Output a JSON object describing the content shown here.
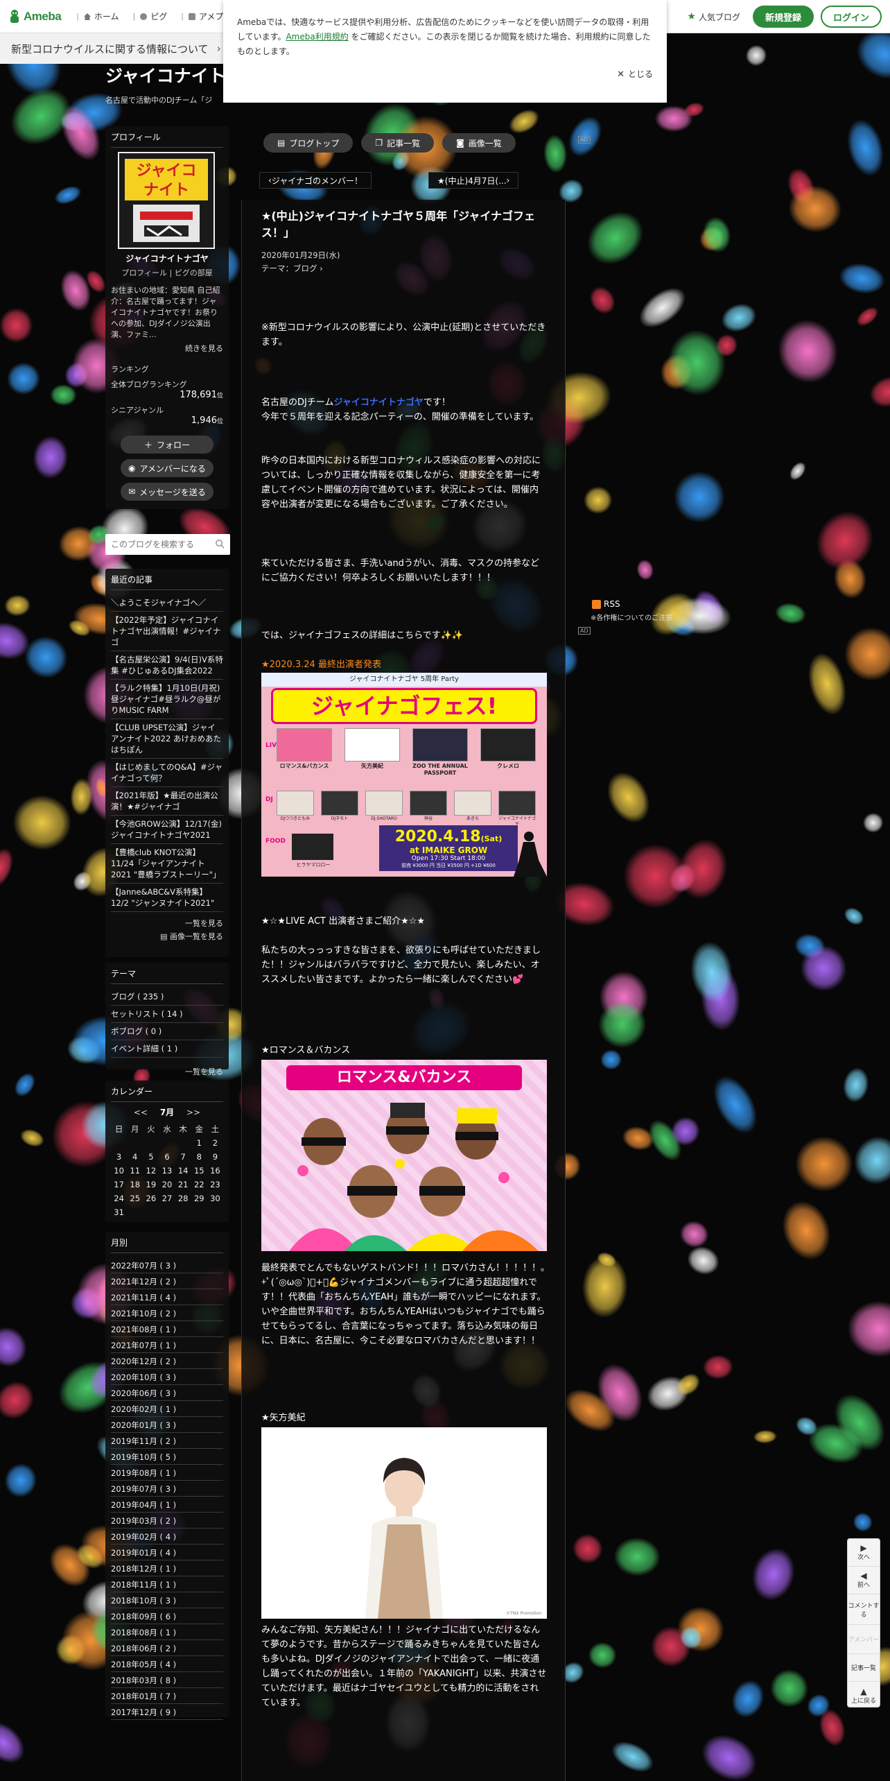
{
  "header": {
    "logo_text": "Ameba",
    "nav": [
      {
        "label": "ホーム",
        "icon": "home-icon"
      },
      {
        "label": "ピグ",
        "icon": "pigg-icon"
      },
      {
        "label": "アメプロ",
        "icon": "ameblo-icon"
      }
    ],
    "popular_label": "人気ブログ",
    "signup_label": "新規登録",
    "login_label": "ログイン"
  },
  "infobar": {
    "text": "新型コロナウイルスに関する情報について"
  },
  "cookie": {
    "text_before": "Amebaでは、快適なサービス提供や利用分析、広告配信のためにクッキーなどを使い訪問データの取得・利用しています。",
    "link_text": "Ameba利用規約",
    "text_after": "をご確認ください。この表示を閉じるか閲覧を続けた場合、利用規約に同意したものとします。",
    "close_label": "とじる"
  },
  "blog": {
    "title": "ジャイコナイトナゴヤ",
    "title_visible": "ジャイコナイト",
    "description": "名古屋で活動中のDJチーム「ジ"
  },
  "profile": {
    "heading": "プロフィール",
    "name": "ジャイコナイトナゴヤ",
    "links": "プロフィール | ピグの部屋",
    "text": "お住まいの地域：愛知県 自己紹介：名古屋で踊ってます！ジャイコナイトナゴヤです！お祭りへの参加、DJダイノジ公演出演、ファミ...",
    "more": "続きを見る",
    "ranking_heading": "ランキング",
    "ranking_all_label": "全体ブログランキング",
    "ranking_all_value": "178,691",
    "ranking_senior_label": "シニアジャンル",
    "ranking_senior_value": "1,946",
    "rank_unit": "位",
    "follow_label": "フォロー",
    "amember_label": "アメンバーになる",
    "message_label": "メッセージを送る"
  },
  "search": {
    "placeholder": "このブログを検索する"
  },
  "recent": {
    "heading": "最近の記事",
    "items": [
      "＼ようこそジャイナゴへ／",
      "【2022年予定】ジャイコナイトナゴヤ出演情報！#ジャイナゴ",
      "【名古屋栄公演】9/4(日)V系特集 #ひじゅあるDJ集会2022",
      "【ラルク特集】1月10日(月祝)昼ジャイナゴ#昼ラルク@昼がりMUSIC FARM",
      "【CLUB UPSET公演】ジャイアンナイト2022 あけおめあたはちぽん",
      "【はじめましてのQ&A】#ジャイナゴって何？",
      "【2021年版】★最近の出演公演！★#ジャイナゴ",
      "【今池GROW公演】12/17(金)ジャイコナイトナゴヤ2021",
      "【豊橋club KNOT公演】11/24「ジャイアンナイト2021 \"豊橋ラブストーリー\"」",
      "【Janne&ABC&V系特集】12/2 \"ジャンヌナイト2021\""
    ],
    "more": "一覧を見る",
    "image_more": "画像一覧を見る"
  },
  "themes": {
    "heading": "テーマ",
    "items": [
      "ブログ ( 235 )",
      "セットリスト ( 14 )",
      "ボブログ ( 0 )",
      "イベント詳細 ( 1 )"
    ],
    "more": "一覧を見る"
  },
  "calendar": {
    "heading": "カレンダー",
    "prev": "<<",
    "month": "7月",
    "next": ">>",
    "weekdays": [
      "日",
      "月",
      "火",
      "水",
      "木",
      "金",
      "土"
    ],
    "weeks": [
      [
        "",
        "",
        "",
        "",
        "",
        "1",
        "2"
      ],
      [
        "3",
        "4",
        "5",
        "6",
        "7",
        "8",
        "9"
      ],
      [
        "10",
        "11",
        "12",
        "13",
        "14",
        "15",
        "16"
      ],
      [
        "17",
        "18",
        "19",
        "20",
        "21",
        "22",
        "23"
      ],
      [
        "24",
        "25",
        "26",
        "27",
        "28",
        "29",
        "30"
      ],
      [
        "31",
        "",
        "",
        "",
        "",
        "",
        ""
      ]
    ]
  },
  "archive": {
    "heading": "月別",
    "items": [
      "2022年07月 ( 3 )",
      "2021年12月 ( 2 )",
      "2021年11月 ( 4 )",
      "2021年10月 ( 2 )",
      "2021年08月 ( 1 )",
      "2021年07月 ( 1 )",
      "2020年12月 ( 2 )",
      "2020年10月 ( 3 )",
      "2020年06月 ( 3 )",
      "2020年02月 ( 1 )",
      "2020年01月 ( 3 )",
      "2019年11月 ( 2 )",
      "2019年10月 ( 5 )",
      "2019年08月 ( 1 )",
      "2019年07月 ( 3 )",
      "2019年04月 ( 1 )",
      "2019年03月 ( 2 )",
      "2019年02月 ( 4 )",
      "2019年01月 ( 4 )",
      "2018年12月 ( 1 )",
      "2018年11月 ( 1 )",
      "2018年10月 ( 3 )",
      "2018年09月 ( 6 )",
      "2018年08月 ( 1 )",
      "2018年06月 ( 2 )",
      "2018年05月 ( 4 )",
      "2018年03月 ( 8 )",
      "2018年01月 ( 7 )",
      "2017年12月 ( 9 )"
    ]
  },
  "main": {
    "tabs": [
      {
        "label": "ブログトップ",
        "icon": "blog-top-icon"
      },
      {
        "label": "記事一覧",
        "icon": "article-list-icon"
      },
      {
        "label": "画像一覧",
        "icon": "camera-icon"
      }
    ],
    "ad_label": "AD",
    "prev_link": "ジャイナゴのメンバー！",
    "next_link": "★(中止)4月7日(..."
  },
  "article": {
    "title": "★(中止)ジャイコナイトナゴヤ５周年「ジャイナゴフェス！」",
    "date": "2020年01月29日(水)",
    "theme": "テーマ：ブログ",
    "p_cancel": "※新型コロナウイルスの影響により、公演中止(延期)とさせていただきます。",
    "p_intro_1": "名古屋のDJチーム",
    "p_intro_link": "ジャイコナイトナゴヤ",
    "p_intro_2": "です！",
    "p_intro_3": "今年で５周年を迎える記念パーティーの、開催の準備をしています。",
    "p_covid": "昨今の日本国内における新型コロナウィルス感染症の影響への対応については、しっかり正確な情報を収集しながら、健康安全を第一に考慮してイベント開催の方向で進めています。状況によっては、開催内容や出演者が変更になる場合もございます。ご了承ください。",
    "p_thanks": "来ていただける皆さま、手洗いandうがい、消毒、マスクの持参などにご協力ください！何卒よろしくお願いいたします！！！",
    "p_details": "では、ジャイナゴフェスの詳細はこちらです✨✨",
    "flyer_caption": "★2020.3.24 最終出演者発表",
    "flyer": {
      "header": "ジャイコナイトナゴヤ 5周年 Party",
      "title": "ジャイナゴフェス!",
      "acts": [
        "ロマンス&バカンス",
        "矢方美紀",
        "ZOO THE ANNUAL PASSPORT",
        "クレメロ"
      ],
      "djs": [
        "DJつつきともみ",
        "DJネモト",
        "DJ.SHOTARO",
        "神谷",
        "あきら",
        "ジャイコナイトナゴヤ"
      ],
      "food": "ヒラヤマロロー",
      "date": "2020.4.18",
      "day": "(Sat)",
      "venue": "at IMAIKE GROW",
      "time": "Open 17:30  Start 18:00",
      "price": "前売 ¥3000 円 当日 ¥3500 円 +1D ¥600",
      "live_tag": "LIVE",
      "dj_tag": "DJ",
      "food_tag": "FOOD"
    },
    "live_heading": "★☆★LIVE ACT 出演者さまご紹介★☆★",
    "p_live": "私たちの大っっっすきな皆さまを、欲張りにも呼ばせていただきました！！ジャンルはバラバラですけど、全力で見たい、楽しみたい、オススメしたい皆さまです。よかったら一緒に楽しんでください💕",
    "romance_heading": "★ロマンス＆バカンス",
    "romance_banner": "ロマンス&バカンス",
    "p_romance": "最終発表でとんでもないゲストバンド！！！ロマバカさん！！！！！｡+ﾟ(´◎ω◎`)ﾟ+｡💪ジャイナゴメンバーもライブに通う超超超憧れです！！代表曲「おちんちんYEAH」誰もが一瞬でハッピーになれます。いや全曲世界平和です。おちんちんYEAHはいつもジャイナゴでも踊らせてもらってるし、合言葉になっちゃってます。落ち込み気味の毎日に、日本に、名古屋に、今こそ必要なロマバカさんだと思います！！",
    "yakata_heading": "★矢方美紀",
    "yakata_credit": "©TNX Promotion",
    "p_yakata": "みんなご存知、矢方美紀さん！！！ジャイナゴに出ていただけるなんて夢のようです。昔からステージで踊るみきちゃんを見ていた皆さんも多いよね。DJダイノジのジャイアンナイトで出会って、一緒に夜通し踊ってくれたのが出会い。１年前の「YAKANIGHT」以来、共演させていただけます。最近はナゴヤセイユウとしても精力的に活動をされています。"
  },
  "rss": {
    "label": "RSS",
    "note": "※各作権についてのご注意"
  },
  "floatnav": {
    "next": "次へ",
    "prev": "前へ",
    "comment": "コメントする",
    "amember": "アメンバー",
    "articles": "記事一覧",
    "top": "上に戻る"
  },
  "colors": {
    "brand_green": "#2d8c3c",
    "link_blue": "#3b6cf5",
    "caption_orange": "#ff8a1a",
    "flyer_pink": "#f3b7c6"
  }
}
